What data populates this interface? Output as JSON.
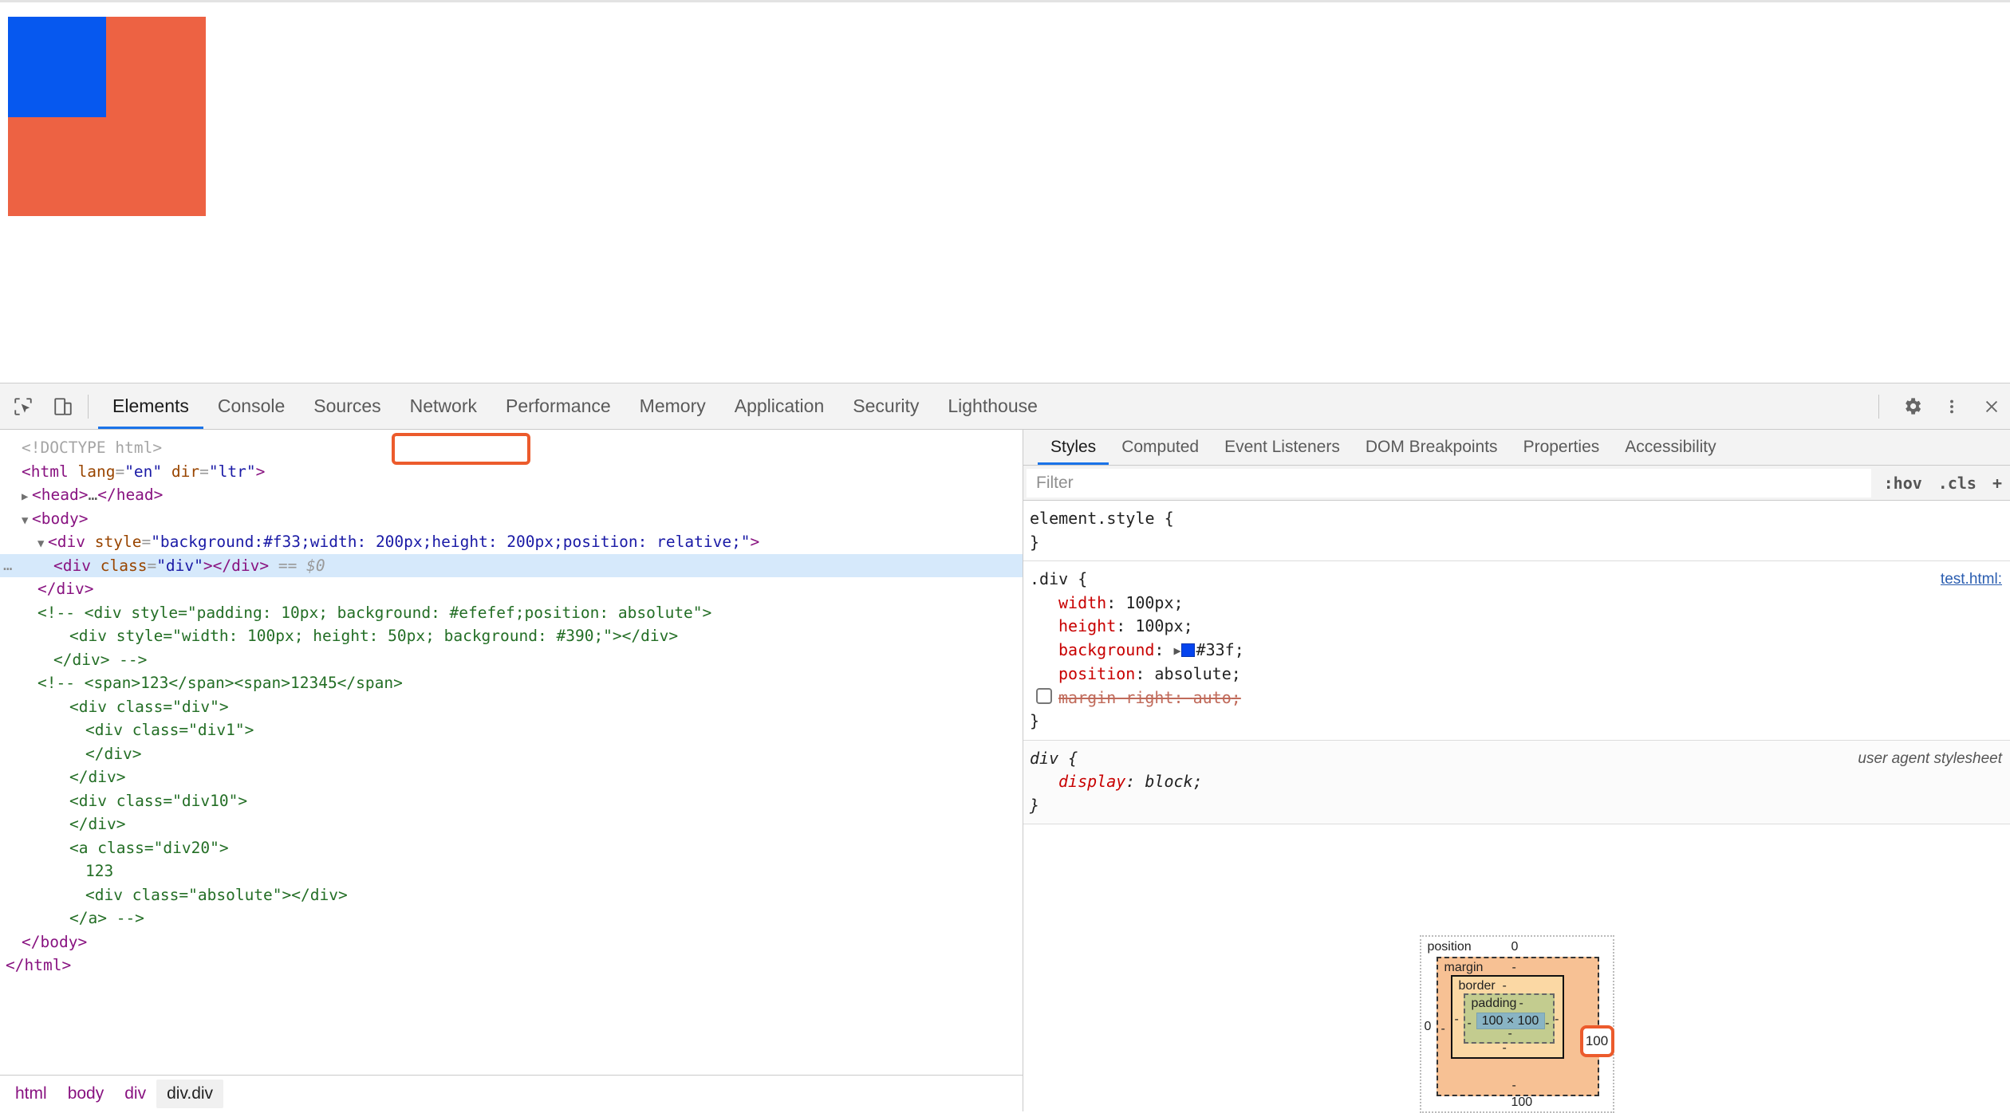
{
  "viewport": {
    "outer_box": {
      "color": "#ed6243",
      "style_text": "background:#f33;width: 200px;height: 200px;position: relative;"
    },
    "inner_box": {
      "color": "#0658ef",
      "class": "div"
    }
  },
  "toolbar": {
    "icons": [
      {
        "name": "inspect-element-icon",
        "label": "Inspect element"
      },
      {
        "name": "device-toolbar-icon",
        "label": "Toggle device toolbar"
      }
    ],
    "tabs": [
      {
        "label": "Elements",
        "active": true
      },
      {
        "label": "Console",
        "active": false
      },
      {
        "label": "Sources",
        "active": false
      },
      {
        "label": "Network",
        "active": false
      },
      {
        "label": "Performance",
        "active": false
      },
      {
        "label": "Memory",
        "active": false
      },
      {
        "label": "Application",
        "active": false
      },
      {
        "label": "Security",
        "active": false
      },
      {
        "label": "Lighthouse",
        "active": false
      }
    ],
    "right_icons": [
      {
        "name": "gear-icon",
        "label": "Settings"
      },
      {
        "name": "kebab-menu-icon",
        "label": "More options"
      },
      {
        "name": "close-icon",
        "label": "Close DevTools"
      }
    ]
  },
  "dom_tree": {
    "lines": [
      "<!DOCTYPE html>",
      "<html lang=\"en\" dir=\"ltr\">",
      "<head>…</head>",
      "<body>",
      "<div style=\"background:#f33;width: 200px;height: 200px;position: relative;\">",
      "<div class=\"div\"></div> == $0",
      "</div>",
      "<!-- <div style=\"padding: 10px; background: #efefef;position: absolute\">",
      "<div style=\"width: 100px; height: 50px; background: #390;\"></div>",
      "</div> -->",
      "<!-- <span>123</span><span>12345</span>",
      "<div class=\"div\">",
      "<div class=\"div1\">",
      "</div>",
      "</div>",
      "<div class=\"div10\">",
      "</div>",
      "<a class=\"div20\">",
      "123",
      "<div class=\"absolute\"></div>",
      "</a> -->",
      "</body>",
      "</html>"
    ],
    "selected_marker": "== $0",
    "annotation_highlight": "position: relative;",
    "annotation_color": "#ec5b2c"
  },
  "breadcrumb": {
    "items": [
      {
        "label": "html",
        "active": false
      },
      {
        "label": "body",
        "active": false
      },
      {
        "label": "div",
        "active": false
      },
      {
        "label": "div.div",
        "active": true
      }
    ]
  },
  "styles": {
    "tabs": [
      {
        "label": "Styles",
        "active": true
      },
      {
        "label": "Computed",
        "active": false
      },
      {
        "label": "Event Listeners",
        "active": false
      },
      {
        "label": "DOM Breakpoints",
        "active": false
      },
      {
        "label": "Properties",
        "active": false
      },
      {
        "label": "Accessibility",
        "active": false
      }
    ],
    "filter_placeholder": "Filter",
    "filter_value": "",
    "filter_actions": [
      ":hov",
      ".cls",
      "+"
    ],
    "rules": [
      {
        "selector": "element.style",
        "origin": "",
        "origin_type": "none",
        "declarations": []
      },
      {
        "selector": ".div",
        "origin": "test.html:",
        "origin_type": "link",
        "declarations": [
          {
            "property": "width",
            "value": "100px",
            "disabled": false,
            "swatch": null
          },
          {
            "property": "height",
            "value": "100px",
            "disabled": false,
            "swatch": null
          },
          {
            "property": "background",
            "value": "#33f",
            "disabled": false,
            "swatch": "#0544ee"
          },
          {
            "property": "position",
            "value": "absolute",
            "disabled": false,
            "swatch": null
          },
          {
            "property": "margin-right",
            "value": "auto",
            "disabled": true,
            "swatch": null
          }
        ]
      },
      {
        "selector": "div",
        "origin": "user agent stylesheet",
        "origin_type": "ua",
        "declarations": [
          {
            "property": "display",
            "value": "block",
            "disabled": false,
            "swatch": null
          }
        ]
      }
    ]
  },
  "box_model": {
    "position_label": "position",
    "position_top": "0",
    "position_left": "0",
    "position_right": "100",
    "position_bottom": "100",
    "margin_label": "margin",
    "margin_top": "-",
    "margin_left": "-",
    "margin_right": "-",
    "margin_bottom": "-",
    "border_label": "border",
    "border_top": "-",
    "border_left": "-",
    "border_right": "-",
    "border_bottom": "-",
    "padding_label": "padding",
    "padding_top": "-",
    "padding_left": "-",
    "padding_right": "-",
    "padding_bottom": "-",
    "content_size": "100 × 100",
    "highlight_value": "100",
    "highlight_color": "#ec5b2c"
  }
}
